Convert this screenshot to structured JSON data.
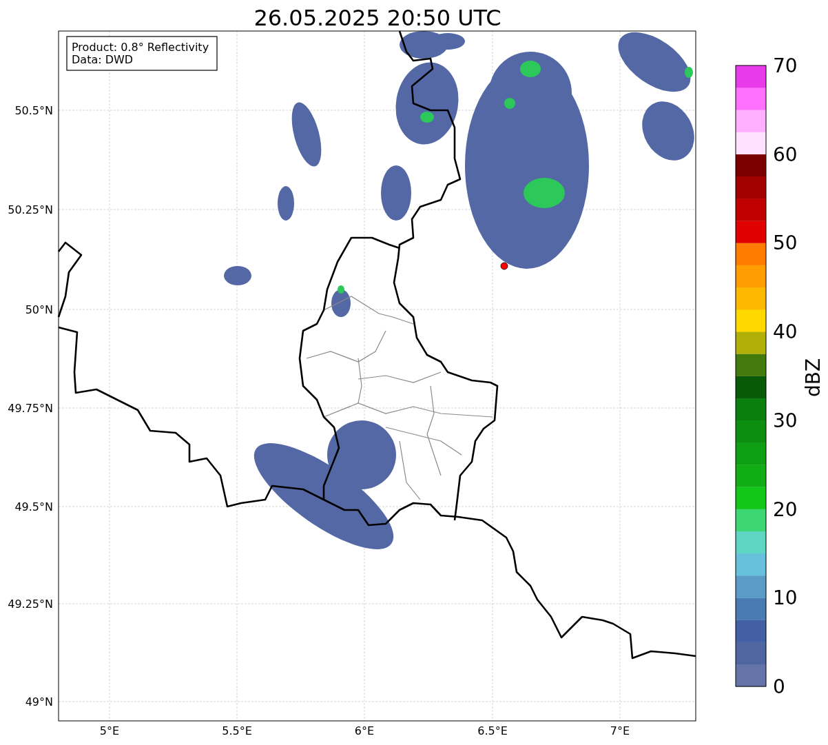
{
  "title": "26.05.2025 20:50 UTC",
  "info_box": {
    "lines": [
      "Product: 0.8° Reflectivity",
      "Data: DWD"
    ]
  },
  "map": {
    "lat_ticks": [
      "50.5°N",
      "50.25°N",
      "50°N",
      "49.75°N",
      "49.5°N",
      "49.25°N",
      "49°N"
    ],
    "lon_ticks": [
      "5°E",
      "5.5°E",
      "6°E",
      "6.5°E",
      "7°E"
    ]
  },
  "colorbar": {
    "label": "dBZ",
    "ticks": [
      "70",
      "60",
      "50",
      "40",
      "30",
      "20",
      "10",
      "0"
    ],
    "segments": [
      {
        "color": "#6574a8"
      },
      {
        "color": "#4f66a0"
      },
      {
        "color": "#4360a4"
      },
      {
        "color": "#4a7ab2"
      },
      {
        "color": "#5a9cc6"
      },
      {
        "color": "#66c0dc"
      },
      {
        "color": "#5fd6c4"
      },
      {
        "color": "#3cd672"
      },
      {
        "color": "#12c718"
      },
      {
        "color": "#10ae14"
      },
      {
        "color": "#0e9e12"
      },
      {
        "color": "#0c8f10"
      },
      {
        "color": "#0a7f0e"
      },
      {
        "color": "#085a08"
      },
      {
        "color": "#447a0c"
      },
      {
        "color": "#b0b008"
      },
      {
        "color": "#ffd800"
      },
      {
        "color": "#ffb800"
      },
      {
        "color": "#ff9c00"
      },
      {
        "color": "#ff7c00"
      },
      {
        "color": "#e00000"
      },
      {
        "color": "#c00000"
      },
      {
        "color": "#a20000"
      },
      {
        "color": "#7a0000"
      },
      {
        "color": "#ffe0ff"
      },
      {
        "color": "#ffb0ff"
      },
      {
        "color": "#ff70ff"
      },
      {
        "color": "#e83ae8"
      }
    ]
  }
}
